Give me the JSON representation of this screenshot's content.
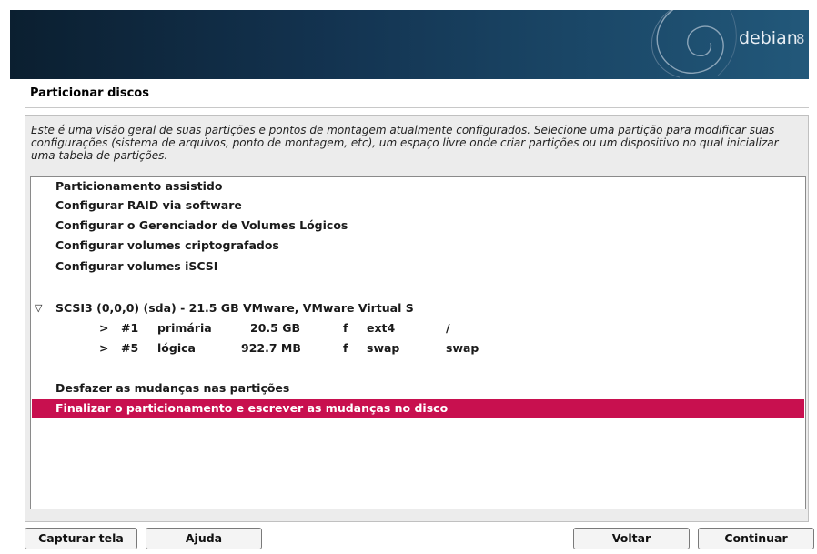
{
  "banner": {
    "logo_text": "debian",
    "logo_version": "8"
  },
  "dialog": {
    "title": "Particionar discos",
    "description": "Este é uma visão geral de suas partições e pontos de montagem atualmente configurados. Selecione uma partição para modificar suas configurações (sistema de arquivos, ponto de montagem, etc), um espaço livre onde criar partições ou um dispositivo no qual inicializar uma tabela de partições."
  },
  "menu": {
    "items": [
      {
        "label": "Particionamento assistido"
      },
      {
        "label": "Configurar RAID via software"
      },
      {
        "label": "Configurar o Gerenciador de Volumes Lógicos"
      },
      {
        "label": "Configurar volumes criptografados"
      },
      {
        "label": "Configurar volumes iSCSI"
      }
    ],
    "disk": {
      "expander": "▽",
      "label": "SCSI3 (0,0,0) (sda) - 21.5 GB VMware, VMware Virtual S",
      "partitions": [
        {
          "arrow": ">",
          "number": "#1",
          "type": "primária",
          "size": "20.5 GB",
          "flag": "f",
          "fs": "ext4",
          "mount": "/"
        },
        {
          "arrow": ">",
          "number": "#5",
          "type": "lógica",
          "size": "922.7 MB",
          "flag": "f",
          "fs": "swap",
          "mount": "swap"
        }
      ]
    },
    "undo_label": "Desfazer as mudanças nas partições",
    "finish_label": "Finalizar o particionamento e escrever as mudanças no disco"
  },
  "buttons": {
    "screenshot": "Capturar tela",
    "help": "Ajuda",
    "back": "Voltar",
    "continue": "Continuar"
  },
  "colors": {
    "selection": "#c8104f",
    "banner_dark": "#0b1f30",
    "banner_light": "#22587a"
  }
}
